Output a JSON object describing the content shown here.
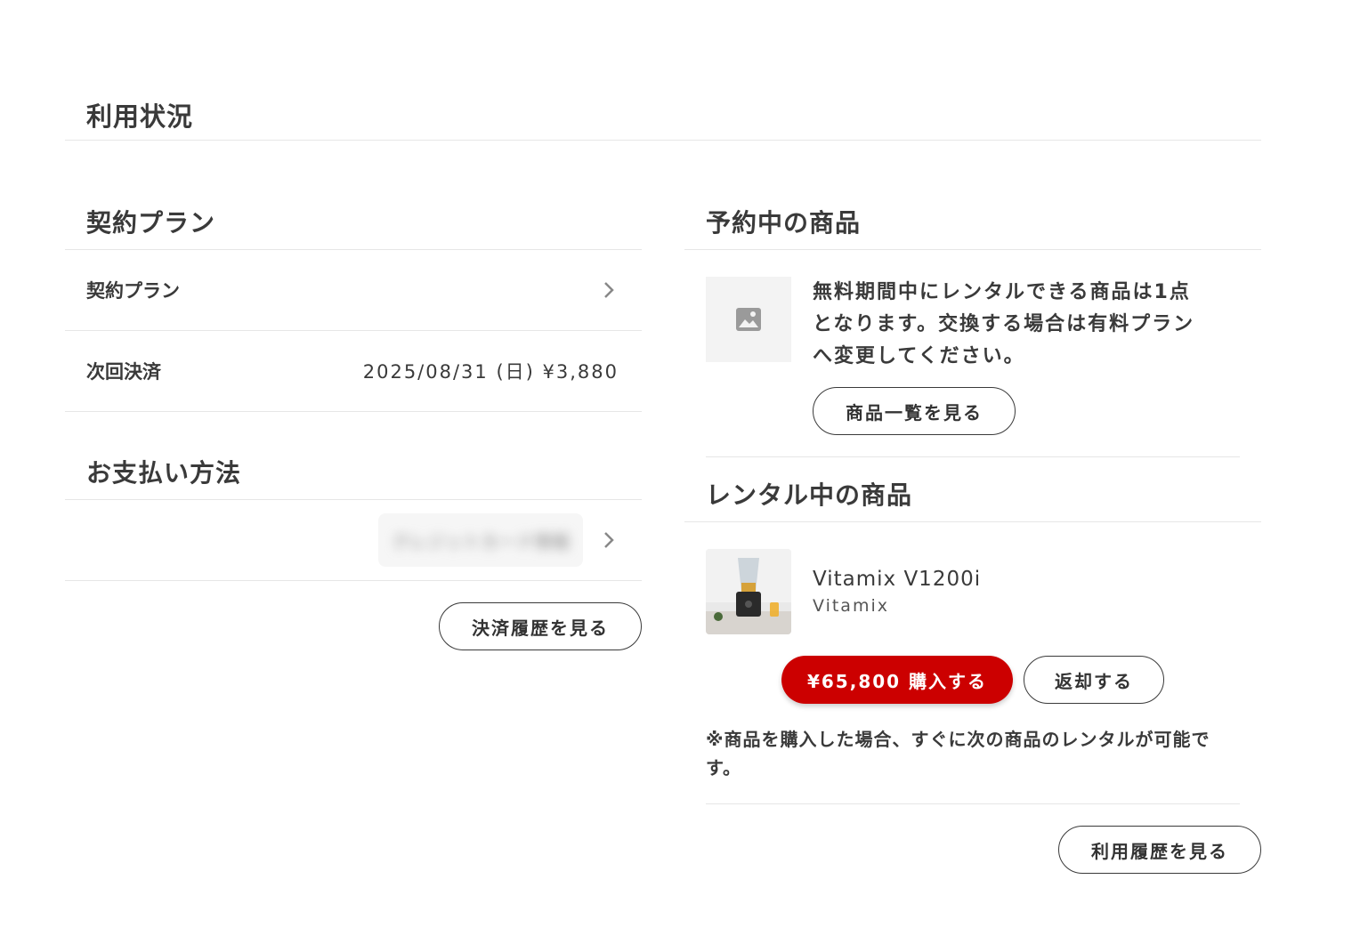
{
  "page": {
    "title": "利用状況"
  },
  "plan": {
    "heading": "契約プラン",
    "row_label": "契約プラン",
    "next_payment_label": "次回決済",
    "next_payment_value": "2025/08/31 (日) ¥3,880"
  },
  "payment": {
    "heading": "お支払い方法",
    "card_value": "クレジットカード情報",
    "history_button": "決済履歴を見る"
  },
  "reserved": {
    "heading": "予約中の商品",
    "message": "無料期間中にレンタルできる商品は1点となります。交換する場合は有料プランへ変更してください。",
    "list_button": "商品一覧を見る"
  },
  "rental": {
    "heading": "レンタル中の商品",
    "product_name": "Vitamix V1200i",
    "product_brand": "Vitamix",
    "buy_button": "¥65,800 購入する",
    "return_button": "返却する",
    "note": "※商品を購入した場合、すぐに次の商品のレンタルが可能です。",
    "history_button": "利用履歴を見る"
  },
  "colors": {
    "accent": "#cc0000",
    "text": "#3a3a3a",
    "divider": "#e6e6e6"
  },
  "icons": {
    "chevron": "chevron-right-icon",
    "placeholder": "image-icon"
  }
}
